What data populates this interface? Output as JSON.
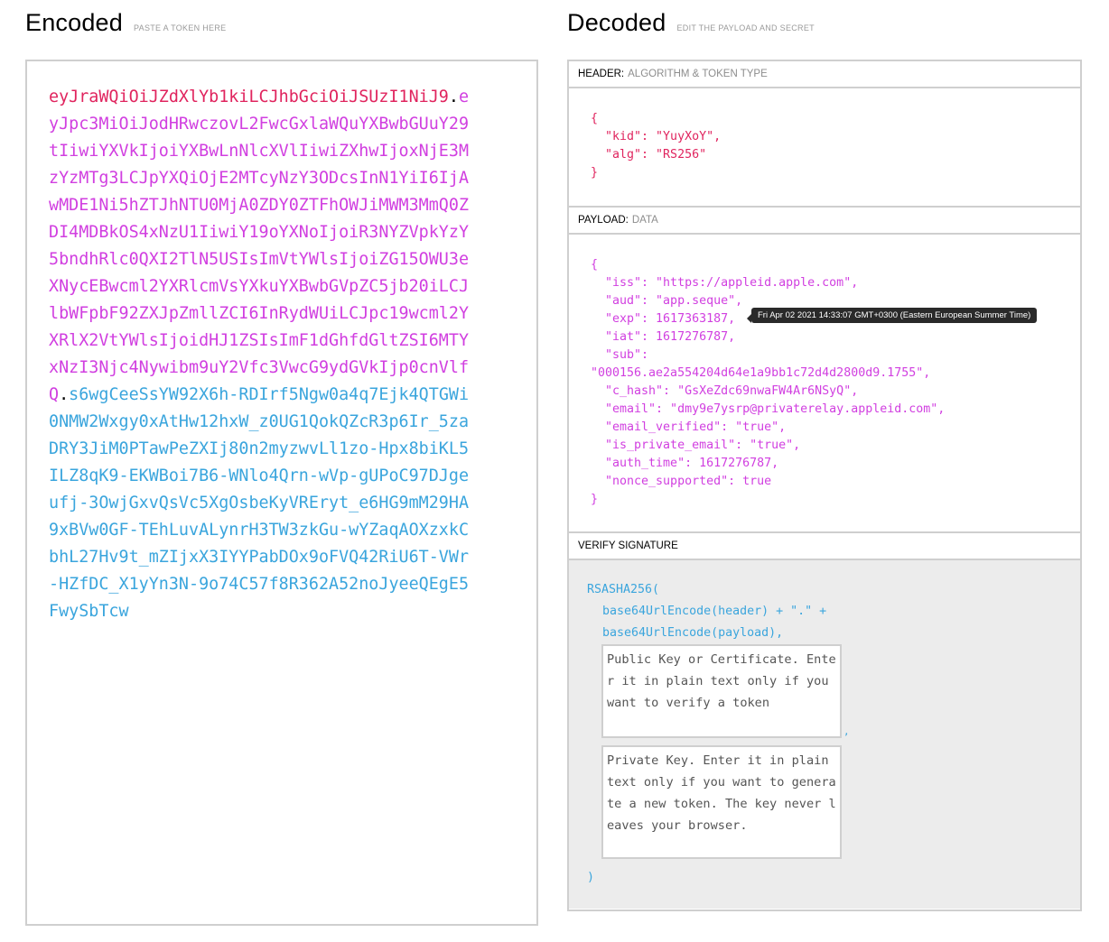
{
  "encoded": {
    "title": "Encoded",
    "subtitle": "PASTE A TOKEN HERE",
    "token_header": "eyJraWQiOiJZdXlYb1kiLCJhbGciOiJSUzI1NiJ9",
    "token_payload": "eyJpc3MiOiJodHRwczovL2FwcGxlaWQuYXBwbGUuY29tIiwiYXVkIjoiYXBwLnNlcXVlIiwiZXhwIjoxNjE3MzYzMTg3LCJpYXQiOjE2MTcyNzY3ODcsInN1YiI6IjAwMDE1Ni5hZTJhNTU0MjA0ZDY0ZTFhOWJiMWM3MmQ0ZDI4MDBkOS4xNzU1IiwiY19oYXNoIjoiR3NYZVpkYzY5bndhRlc0QXI2TlN5USIsImVtYWlsIjoiZG15OWU3eXNycEBwcml2YXRlcmVsYXkuYXBwbGVpZC5jb20iLCJlbWFpbF92ZXJpZmllZCI6InRydWUiLCJpc19wcml2YXRlX2VtYWlsIjoidHJ1ZSIsImF1dGhfdGltZSI6MTYxNzI3Njc4Nywibm9uY2Vfc3VwcG9ydGVkIjp0cnVlfQ",
    "token_signature": "s6wgCeeSsYW92X6h-RDIrf5Ngw0a4q7Ejk4QTGWi0NMW2Wxgy0xAtHw12hxW_z0UG1QokQZcR3p6Ir_5zaDRY3JiM0PTawPeZXIj80n2myzwvLl1zo-Hpx8biKL5ILZ8qK9-EKWBoi7B6-WNlo4Qrn-wVp-gUPoC97DJgeufj-3OwjGxvQsVc5XgOsbeKyVREryt_e6HG9mM29HA9xBVw0GF-TEhLuvALynrH3TW3zkGu-wYZaqAOXzxkCbhL27Hv9t_mZIjxX3IYYPabDOx9oFVQ42RiU6T-VWr-HZfDC_X1yYn3N-9o74C57f8R362A52noJyeeQEgE5FwySbTcw",
    "dot": "."
  },
  "decoded": {
    "title": "Decoded",
    "subtitle": "EDIT THE PAYLOAD AND SECRET",
    "header_label": "HEADER:",
    "header_sub": "ALGORITHM & TOKEN TYPE",
    "header_json": "{\n  \"kid\": \"YuyXoY\",\n  \"alg\": \"RS256\"\n}",
    "payload_label": "PAYLOAD:",
    "payload_sub": "DATA",
    "payload_json": "{\n  \"iss\": \"https://appleid.apple.com\",\n  \"aud\": \"app.seque\",\n  \"exp\": 1617363187,\n  \"iat\": 1617276787,\n  \"sub\":\n\"000156.ae2a554204d64e1a9bb1c72d4d2800d9.1755\",\n  \"c_hash\": \"GsXeZdc69nwaFW4Ar6NSyQ\",\n  \"email\": \"dmy9e7ysrp@privaterelay.appleid.com\",\n  \"email_verified\": \"true\",\n  \"is_private_email\": \"true\",\n  \"auth_time\": 1617276787,\n  \"nonce_supported\": true\n}",
    "exp_tooltip": "Fri Apr 02 2021 14:33:07 GMT+0300 (Eastern European Summer Time)",
    "verify_label": "VERIFY SIGNATURE",
    "sig_fn": "RSASHA256(",
    "sig_line2": "base64UrlEncode(header) + \".\" +",
    "sig_line3": "base64UrlEncode(payload),",
    "public_key_placeholder": "Public Key or Certificate. Enter it in plain text only if you want to verify a token",
    "comma": ",",
    "private_key_placeholder": "Private Key. Enter it in plain text only if you want to generate a new token. The key never leaves your browser.",
    "sig_close": ")"
  },
  "colors": {
    "header": "#e0245e",
    "payload": "#d13fe0",
    "signature": "#3aa5dd"
  }
}
